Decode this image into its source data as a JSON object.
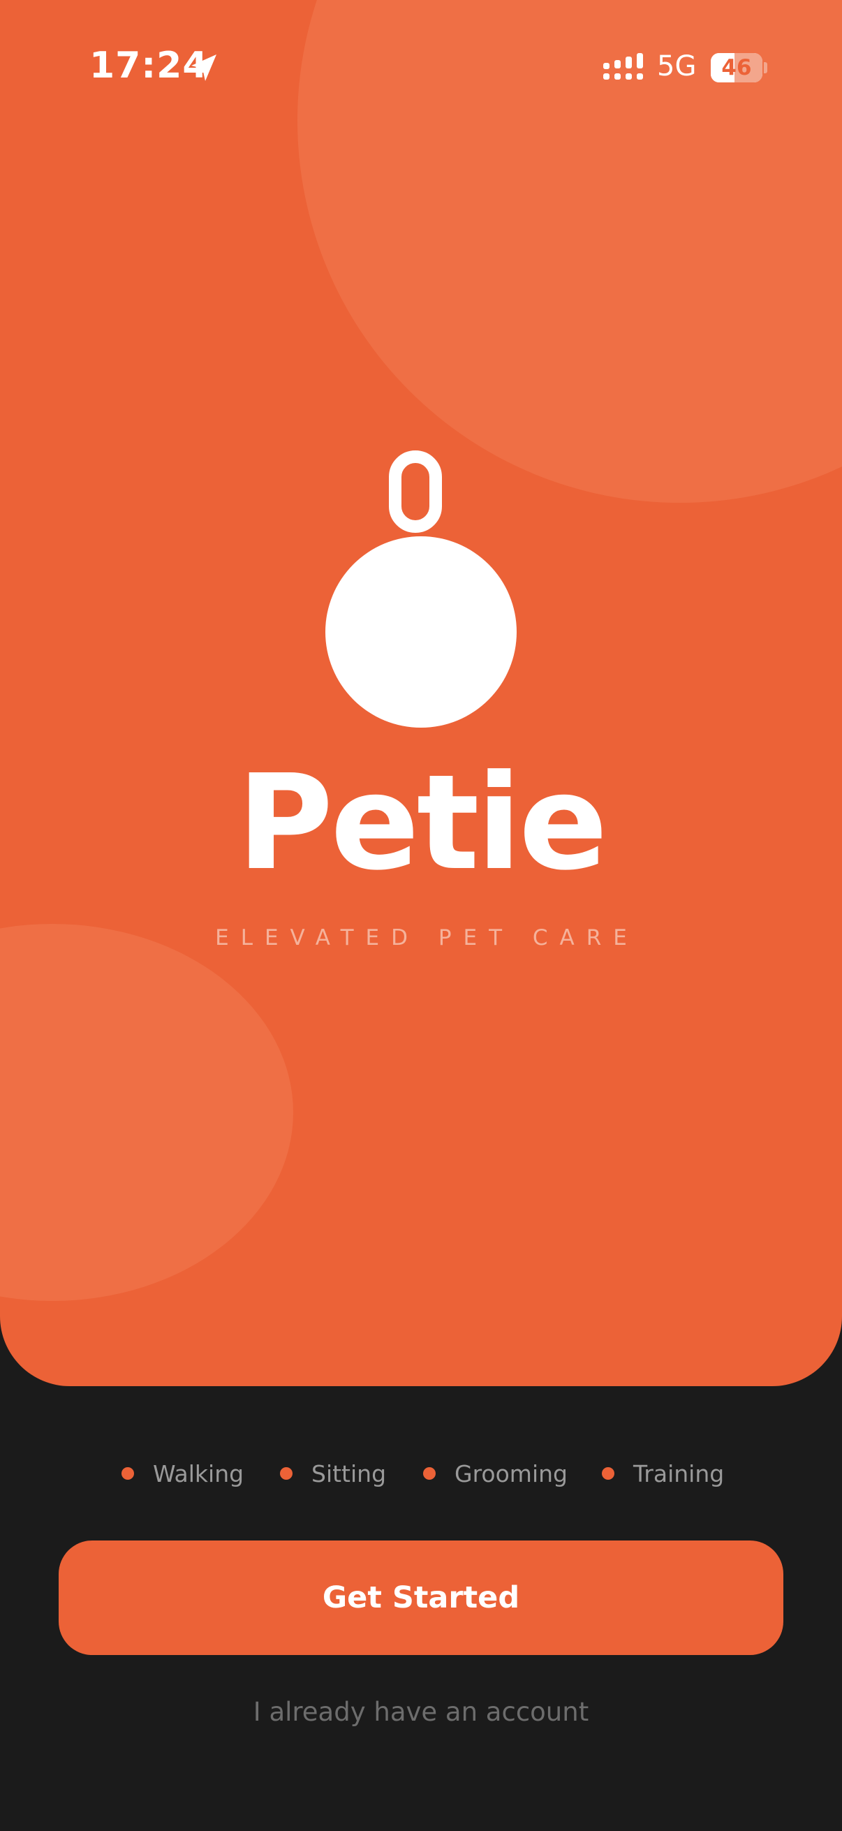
{
  "status_bar": {
    "time": "17:24",
    "network": "5G",
    "battery": "46",
    "battery_level": 0.46
  },
  "brand": {
    "name": "Petie",
    "tagline": "ELEVATED PET CARE"
  },
  "services": [
    {
      "label": "Walking"
    },
    {
      "label": "Sitting"
    },
    {
      "label": "Grooming"
    },
    {
      "label": "Training"
    }
  ],
  "actions": {
    "get_started": "Get Started",
    "login": "I already have an account"
  },
  "colors": {
    "accent": "#ec6237",
    "background": "#1b1b1b"
  },
  "icons": {
    "location": "location-arrow-icon",
    "signal": "signal-bars-icon",
    "logo": "pet-tag-logo-icon"
  }
}
